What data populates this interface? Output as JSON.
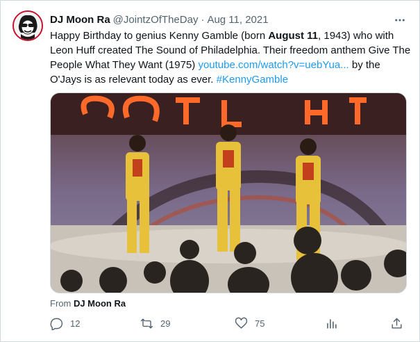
{
  "tweet": {
    "display_name": "DJ Moon Ra",
    "handle": "@JointzOfTheDay",
    "separator": "·",
    "date": "Aug 11, 2021",
    "text_1": "Happy Birthday to genius Kenny Gamble (born ",
    "text_bold": "August 11",
    "text_2": ", 1943) who with Leon Huff created The Sound of Philadelphia. Their freedom anthem Give The People What They Want (1975) ",
    "link_url": "youtube.com/watch?v=uebYua...",
    "text_3": " by the O'Jays is as relevant today as ever. ",
    "hashtag": "#KennyGamble",
    "from_prefix": "From ",
    "from_name": "DJ Moon Ra"
  },
  "actions": {
    "reply_count": "12",
    "retweet_count": "29",
    "like_count": "75"
  },
  "icons": {
    "more": "more-icon",
    "reply": "reply-icon",
    "retweet": "retweet-icon",
    "like": "heart-icon",
    "analytics": "analytics-icon",
    "share": "share-icon"
  },
  "colors": {
    "link": "#1d9bf0",
    "secondary": "#536471",
    "stage_yellow": "#e8c13a",
    "stage_red": "#c2411c"
  }
}
